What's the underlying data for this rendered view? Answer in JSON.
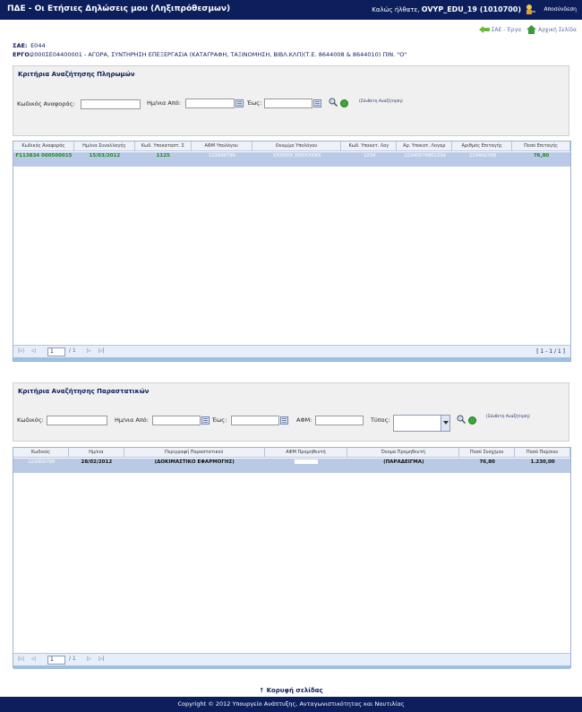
{
  "header": {
    "title": "ΠΔΕ - Οι Ετήσιες Δηλώσεις μου (Ληξιπρόθεσμων)",
    "welcome_prefix": "Καλώς ήλθατε,",
    "user": "OVYP_EDU_19 (1010700)",
    "logout": "Αποσύνδεση"
  },
  "nav": {
    "sae_projects": "ΣΑΕ - Έργα",
    "home": "Αρχική Σελίδα"
  },
  "info": {
    "sae_label": "ΣΑΕ:",
    "sae_value": "E044",
    "project_label": "ΕΡΓΟ:",
    "project_value": "2000ΣΕ04400001 - ΑΓΟΡΑ, ΣΥΝΤΗΡΗΣΗ ΕΠΕΞΕΡΓΑΣΙΑ (ΚΑΤΑΓΡΑΦΗ, ΤΑΞΙΝΟΜΗΣΗ, ΒΙΒΛ.ΚΛΠ)(Τ.Ε. 8644008 & 8644010) ΠΙΝ. \"Ο\""
  },
  "payments": {
    "title": "Κριτήρια Αναζήτησης Πληρωμών",
    "ref_code_label": "Κωδικός Αναφοράς:",
    "date_from_label": "Ημ/νια Από:",
    "date_to_label": "Έως:",
    "advanced": "(Σύνθετη Αναζήτηση)",
    "columns": [
      "Κωδικός Αναφοράς",
      "Ημ/νια Συναλλαγής",
      "Κωδ. Υποκαταστ. Σ",
      "ΑΦΜ Υπολόγου",
      "Ονομ/μο Υπολόγου",
      "Κωδ. Υποκατ. Λογ",
      "Αρ. Υποκατ. Λογαρ",
      "Αριθμός Επιταγής",
      "Ποσό Επιταγής"
    ],
    "rows": [
      {
        "ref": "F113834 000500015",
        "date": "15/03/2012",
        "branch": "1125",
        "afm": "123456789",
        "name": "XXXXXX XXXXXXXX",
        "acc_code": "1234",
        "acc_no": "12345678901234",
        "check_no": "123456789",
        "amount": "76,80"
      }
    ],
    "page_value": "1",
    "page_total": "/ 1",
    "range": "[ 1 - 1 / 1 ]"
  },
  "documents": {
    "title": "Κριτήρια Αναζήτησης Παραστατικών",
    "code_label": "Κωδικός:",
    "date_from_label": "Ημ/νια Από:",
    "date_to_label": "Έως:",
    "afm_label": "ΑΦΜ:",
    "type_label": "Τύπος:",
    "advanced": "(Σύνθετη Αναζήτηση)",
    "columns": [
      "Κωδικός",
      "Ημ/νια",
      "Περιγραφή Παραστατικού",
      "ΑΦΜ Προμηθευτή",
      "Όνομα Προμηθευτή",
      "Ποσό Συσχ/μου",
      "Ποσό Παρ/κου"
    ],
    "rows": [
      {
        "code": "123456789",
        "date": "28/02/2012",
        "desc": "(ΔΟΚΙΜΑΣΤΙΚΟ ΕΦΑΡΜΟΓΗΣ)",
        "afm": "",
        "supplier": "(ΠΑΡΑΔΕΙΓΜΑ)",
        "assoc": "76,80",
        "total": "1.230,00"
      }
    ],
    "page_value": "1",
    "page_total": "/ 1"
  },
  "back_to_top": "↑ Κορυφή σελίδας",
  "footer": "Copyright © 2012 Υπουργείο Ανάπτυξης, Ανταγωνιστικότητας και Ναυτιλίας"
}
